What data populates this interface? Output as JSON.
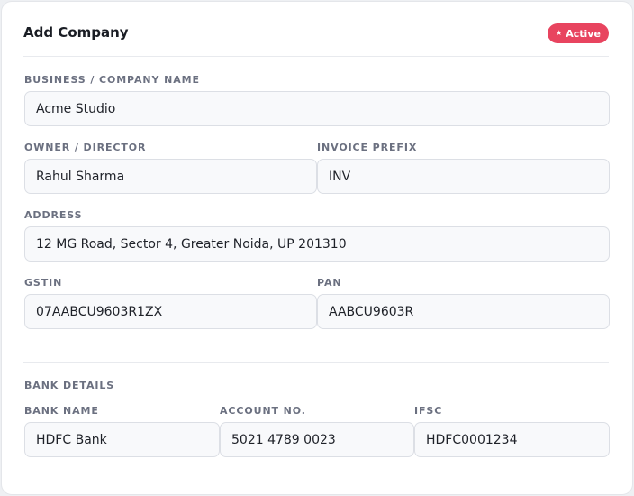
{
  "form": {
    "title": "Add Company",
    "status_badge": {
      "label": "Active",
      "icon": "star-icon",
      "color": "#e8445f"
    },
    "fields": {
      "company_name": {
        "label": "BUSINESS / COMPANY NAME",
        "value": "Acme Studio"
      },
      "owner": {
        "label": "OWNER / DIRECTOR",
        "value": "Rahul Sharma"
      },
      "invoice_prefix": {
        "label": "INVOICE PREFIX",
        "value": "INV"
      },
      "address": {
        "label": "ADDRESS",
        "value": "12 MG Road, Sector 4, Greater Noida, UP 201310"
      },
      "gstin": {
        "label": "GSTIN",
        "value": "07AABCU9603R1ZX"
      },
      "pan": {
        "label": "PAN",
        "value": "AABCU9603R"
      }
    },
    "bank": {
      "section_title": "BANK DETAILS",
      "bank_name": {
        "label": "BANK NAME",
        "value": "HDFC Bank"
      },
      "account_no": {
        "label": "ACCOUNT NO.",
        "value": "5021 4789 0023"
      },
      "ifsc": {
        "label": "IFSC",
        "value": "HDFC0001234"
      }
    }
  }
}
